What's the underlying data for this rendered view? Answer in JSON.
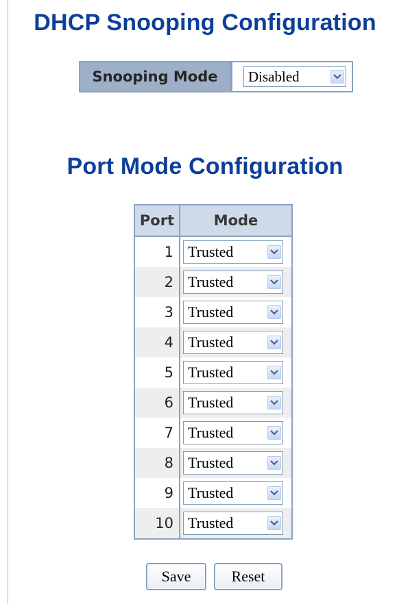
{
  "page": {
    "title": "DHCP Snooping Configuration",
    "subtitle": "Port Mode Configuration"
  },
  "snooping": {
    "label": "Snooping Mode",
    "value": "Disabled"
  },
  "port_table": {
    "headers": {
      "port": "Port",
      "mode": "Mode"
    },
    "rows": [
      {
        "port": "1",
        "mode": "Trusted"
      },
      {
        "port": "2",
        "mode": "Trusted"
      },
      {
        "port": "3",
        "mode": "Trusted"
      },
      {
        "port": "4",
        "mode": "Trusted"
      },
      {
        "port": "5",
        "mode": "Trusted"
      },
      {
        "port": "6",
        "mode": "Trusted"
      },
      {
        "port": "7",
        "mode": "Trusted"
      },
      {
        "port": "8",
        "mode": "Trusted"
      },
      {
        "port": "9",
        "mode": "Trusted"
      },
      {
        "port": "10",
        "mode": "Trusted"
      }
    ]
  },
  "buttons": {
    "save": "Save",
    "reset": "Reset"
  },
  "colors": {
    "title": "#0d3f99",
    "header_bg": "#cfdae8",
    "label_bg": "#9eb0c8",
    "border": "#8aa2c2",
    "row_alt": "#eeeeee"
  },
  "icons": {
    "dropdown": "chevron-down-icon"
  }
}
